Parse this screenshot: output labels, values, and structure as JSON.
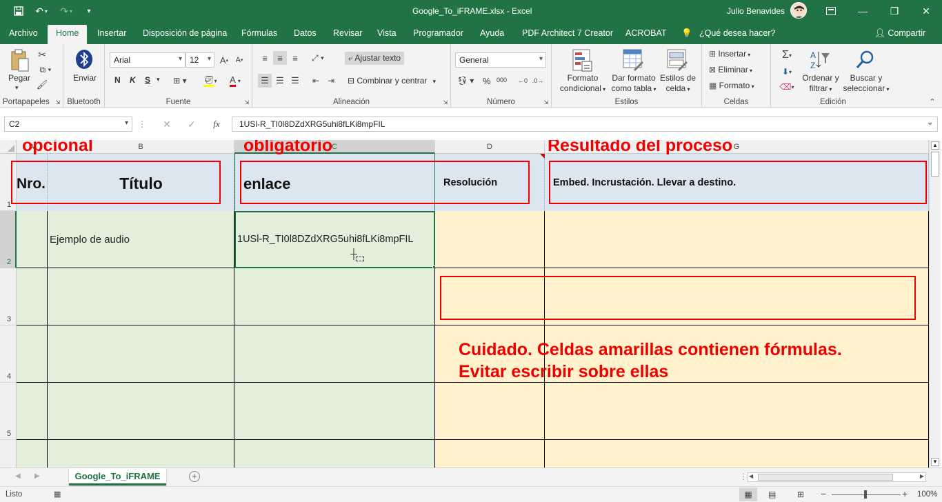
{
  "window": {
    "filename": "Google_To_iFRAME.xlsx",
    "app_title": "Google_To_iFRAME.xlsx  -  Excel",
    "user": "Julio Benavides"
  },
  "tabs": [
    {
      "label": "Archivo"
    },
    {
      "label": "Home"
    },
    {
      "label": "Insertar"
    },
    {
      "label": "Disposición de página"
    },
    {
      "label": "Fórmulas"
    },
    {
      "label": "Datos"
    },
    {
      "label": "Revisar"
    },
    {
      "label": "Vista"
    },
    {
      "label": "Programador"
    },
    {
      "label": "Ayuda"
    },
    {
      "label": "PDF Architect 7 Creator"
    },
    {
      "label": "ACROBAT"
    },
    {
      "label": "¿Qué desea hacer?"
    }
  ],
  "share_label": "Compartir",
  "ribbon": {
    "clipboard": {
      "paste_label": "Pegar",
      "group_label": "Portapapeles"
    },
    "bluetooth": {
      "send_label": "Enviar",
      "group_label": "Bluetooth"
    },
    "font": {
      "family": "Arial",
      "size": "12",
      "group_label": "Fuente",
      "bold": "N",
      "italic": "K",
      "underline": "S"
    },
    "alignment": {
      "wrap_label": "Ajustar texto",
      "merge_label": "Combinar y centrar",
      "group_label": "Alineación"
    },
    "number": {
      "format": "General",
      "group_label": "Número",
      "percent": "%",
      "thousands": "000"
    },
    "styles": {
      "conditional_label_1": "Formato",
      "conditional_label_2": "condicional",
      "table_label_1": "Dar formato",
      "table_label_2": "como tabla",
      "cell_styles_label_1": "Estilos de",
      "cell_styles_label_2": "celda",
      "group_label": "Estilos"
    },
    "cells": {
      "insert_label": "Insertar",
      "delete_label": "Eliminar",
      "format_label": "Formato",
      "group_label": "Celdas"
    },
    "editing": {
      "sort_label_1": "Ordenar y",
      "sort_label_2": "filtrar",
      "find_label_1": "Buscar y",
      "find_label_2": "seleccionar",
      "group_label": "Edición"
    }
  },
  "formula_bar": {
    "name_box": "C2",
    "fx": "fx",
    "content": "1USl-R_TI0l8DZdXRG5uhi8fLKi8mpFIL"
  },
  "columns": [
    "A",
    "B",
    "C",
    "D",
    "G"
  ],
  "rows": [
    "1",
    "2",
    "3",
    "4",
    "5"
  ],
  "cells": {
    "A1": "Nro.",
    "B1": "Título",
    "C1": "enlace",
    "D1": "Resolución",
    "E1": "Embed. Incrustación. Llevar a destino.",
    "B2": "Ejemplo de audio",
    "C2": "1USl-R_TI0l8DZdXRG5uhi8fLKi8mpFIL"
  },
  "annotations": {
    "opcional": "opcional",
    "obligatorio": "obligatorio",
    "resultado": "Resultado del proceso",
    "warning_1": "Cuidado. Celdas amarillas contienen fórmulas.",
    "warning_2": "Evitar escribir sobre ellas"
  },
  "sheet_tab": "Google_To_iFRAME",
  "status": {
    "ready": "Listo",
    "zoom": "100%"
  },
  "colors": {
    "excel_green": "#217346",
    "header_blue": "#dce6f1",
    "green_fill": "#e2efda",
    "yellow_fill": "#fff2cc",
    "annotation_red": "#e00000"
  }
}
